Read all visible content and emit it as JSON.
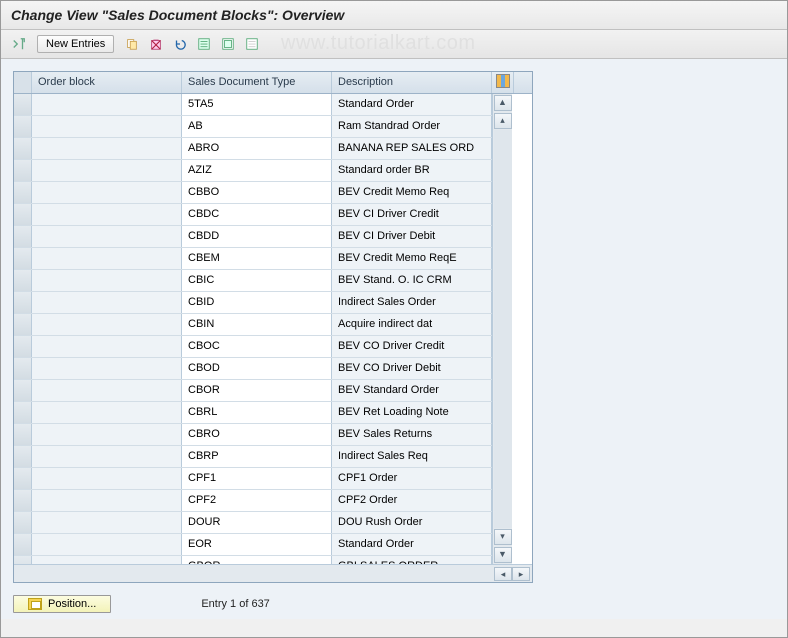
{
  "title": "Change View \"Sales Document Blocks\": Overview",
  "watermark": "www.tutorialkart.com",
  "toolbar": {
    "new_entries": "New Entries"
  },
  "table": {
    "headers": {
      "order_block": "Order block",
      "doc_type": "Sales Document Type",
      "description": "Description"
    },
    "rows": [
      {
        "order": "",
        "type": "5TA5",
        "desc": "Standard Order"
      },
      {
        "order": "",
        "type": "AB",
        "desc": "Ram Standrad Order"
      },
      {
        "order": "",
        "type": "ABRO",
        "desc": "BANANA REP SALES ORD"
      },
      {
        "order": "",
        "type": "AZIZ",
        "desc": "Standard order BR"
      },
      {
        "order": "",
        "type": "CBBO",
        "desc": "BEV Credit Memo Req"
      },
      {
        "order": "",
        "type": "CBDC",
        "desc": "BEV CI Driver Credit"
      },
      {
        "order": "",
        "type": "CBDD",
        "desc": "BEV CI Driver Debit"
      },
      {
        "order": "",
        "type": "CBEM",
        "desc": "BEV Credit Memo ReqE"
      },
      {
        "order": "",
        "type": "CBIC",
        "desc": "BEV Stand. O. IC CRM"
      },
      {
        "order": "",
        "type": "CBID",
        "desc": "Indirect Sales Order"
      },
      {
        "order": "",
        "type": "CBIN",
        "desc": "Acquire indirect dat"
      },
      {
        "order": "",
        "type": "CBOC",
        "desc": "BEV CO Driver Credit"
      },
      {
        "order": "",
        "type": "CBOD",
        "desc": "BEV CO Driver Debit"
      },
      {
        "order": "",
        "type": "CBOR",
        "desc": "BEV Standard Order"
      },
      {
        "order": "",
        "type": "CBRL",
        "desc": "BEV Ret Loading Note"
      },
      {
        "order": "",
        "type": "CBRO",
        "desc": "BEV Sales Returns"
      },
      {
        "order": "",
        "type": "CBRP",
        "desc": "Indirect Sales Req"
      },
      {
        "order": "",
        "type": "CPF1",
        "desc": "CPF1 Order"
      },
      {
        "order": "",
        "type": "CPF2",
        "desc": "CPF2 Order"
      },
      {
        "order": "",
        "type": "DOUR",
        "desc": "DOU Rush Order"
      },
      {
        "order": "",
        "type": "EOR",
        "desc": " Standard Order"
      },
      {
        "order": "",
        "type": "GBOR",
        "desc": "GBI SALES ORDER"
      }
    ]
  },
  "footer": {
    "position_btn": "Position...",
    "entry_text": "Entry 1 of 637"
  }
}
